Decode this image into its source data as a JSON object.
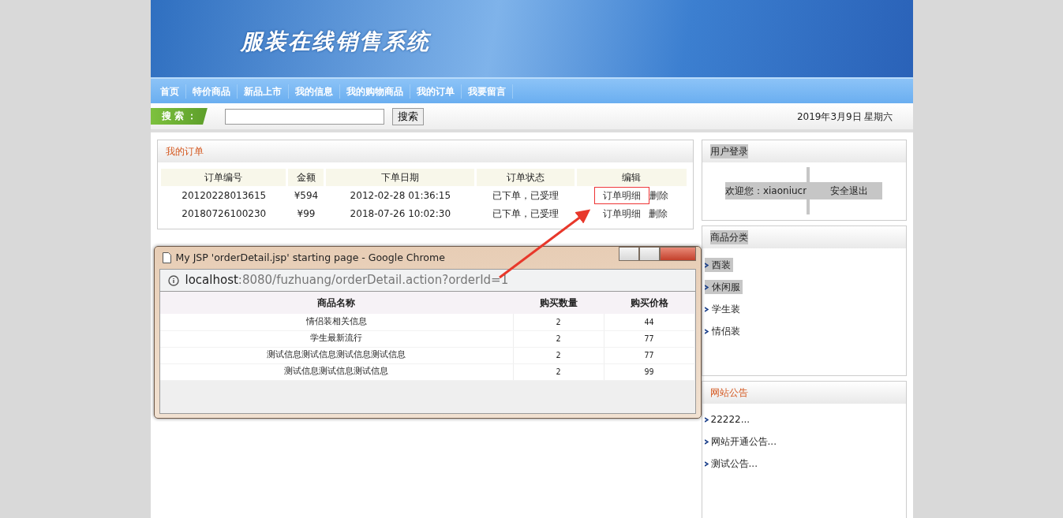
{
  "banner": {
    "title": "服装在线销售系统"
  },
  "nav": [
    {
      "label": "首页"
    },
    {
      "label": "特价商品"
    },
    {
      "label": "新品上市"
    },
    {
      "label": "我的信息"
    },
    {
      "label": "我的购物商品"
    },
    {
      "label": "我的订单"
    },
    {
      "label": "我要留言"
    }
  ],
  "search": {
    "label": "搜 索 ：",
    "button": "搜索",
    "date": "2019年3月9日 星期六"
  },
  "orders": {
    "title": "我的订单",
    "columns": [
      "订单编号",
      "金额",
      "下单日期",
      "订单状态",
      "编辑"
    ],
    "rows": [
      {
        "id": "20120228013615",
        "amount": "¥594",
        "date": "2012-02-28 01:36:15",
        "status": "已下单，已受理",
        "detail": "订单明细",
        "delete": "删除",
        "highlighted": true
      },
      {
        "id": "20180726100230",
        "amount": "¥99",
        "date": "2018-07-26 10:02:30",
        "status": "已下单，已受理",
        "detail": "订单明细",
        "delete": "删除",
        "highlighted": false
      }
    ]
  },
  "popup": {
    "title": "My JSP 'orderDetail.jsp' starting page - Google Chrome",
    "url_host": "localhost",
    "url_rest": ":8080/fuzhuang/orderDetail.action?orderId=1",
    "columns": [
      "商品名称",
      "购买数量",
      "购买价格"
    ],
    "rows": [
      [
        "情侣装相关信息",
        "2",
        "44"
      ],
      [
        "学生最新流行",
        "2",
        "77"
      ],
      [
        "测试信息测试信息测试信息测试信息",
        "2",
        "77"
      ],
      [
        "测试信息测试信息测试信息",
        "2",
        "99"
      ]
    ]
  },
  "login": {
    "title": "用户登录",
    "welcome": "欢迎您：xiaoniucr",
    "logout": "安全退出"
  },
  "categories": {
    "title": "商品分类",
    "items": [
      {
        "label": "西装",
        "highlighted": true
      },
      {
        "label": "休闲服",
        "highlighted": true
      },
      {
        "label": "学生装",
        "highlighted": false
      },
      {
        "label": "情侣装",
        "highlighted": false
      }
    ]
  },
  "notices": {
    "title": "网站公告",
    "items": [
      "22222...",
      "网站开通公告...",
      "测试公告..."
    ]
  }
}
